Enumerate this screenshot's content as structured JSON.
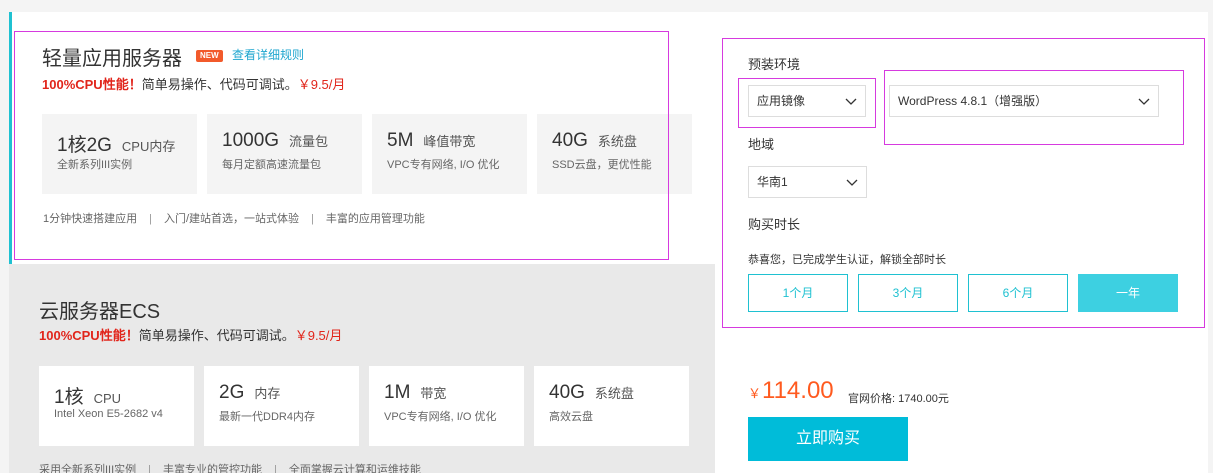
{
  "light_server": {
    "title": "轻量应用服务器",
    "badge": "NEW",
    "detail_link": "查看详细规则",
    "promo_bold": "100%CPU性能！",
    "promo_text": "简单易操作、代码可调试。",
    "promo_price": "￥9.5/月",
    "specs": [
      {
        "value": "1核2G",
        "unit": "CPU内存",
        "desc": "全新系列III实例"
      },
      {
        "value": "1000G",
        "unit": "流量包",
        "desc": "每月定额高速流量包"
      },
      {
        "value": "5M",
        "unit": "峰值带宽",
        "desc": "VPC专有网络, I/O 优化"
      },
      {
        "value": "40G",
        "unit": "系统盘",
        "desc": "SSD云盘，更优性能"
      }
    ],
    "features": [
      "1分钟快速搭建应用",
      "入门/建站首选，一站式体验",
      "丰富的应用管理功能"
    ]
  },
  "ecs": {
    "title": "云服务器ECS",
    "promo_bold": "100%CPU性能！",
    "promo_text": "简单易操作、代码可调试。",
    "promo_price": "￥9.5/月",
    "specs": [
      {
        "value": "1核",
        "unit": "CPU",
        "desc": "Intel Xeon E5-2682 v4"
      },
      {
        "value": "2G",
        "unit": "内存",
        "desc": "最新一代DDR4内存"
      },
      {
        "value": "1M",
        "unit": "带宽",
        "desc": "VPC专有网络, I/O 优化"
      },
      {
        "value": "40G",
        "unit": "系统盘",
        "desc": "高效云盘"
      }
    ],
    "features": [
      "采用全新系列III实例",
      "丰富专业的管控功能",
      "全面掌握云计算和运维技能"
    ]
  },
  "config": {
    "env_label": "预装环境",
    "env_type": "应用镜像",
    "env_image": "WordPress 4.8.1（增强版）",
    "region_label": "地域",
    "region_value": "华南1",
    "duration_label": "购买时长",
    "student_note": "恭喜您，已完成学生认证，解锁全部时长",
    "durations": [
      "1个月",
      "3个月",
      "6个月",
      "一年"
    ],
    "selected_duration": "一年"
  },
  "purchase": {
    "currency": "￥",
    "price": "114.00",
    "official_price": "官网价格: 1740.00元",
    "buy_label": "立即购买"
  },
  "colors": {
    "accent": "#1fc1d1",
    "price": "#ff5a1f",
    "promo_red": "#e1251b",
    "annotation": "#d63adf"
  }
}
